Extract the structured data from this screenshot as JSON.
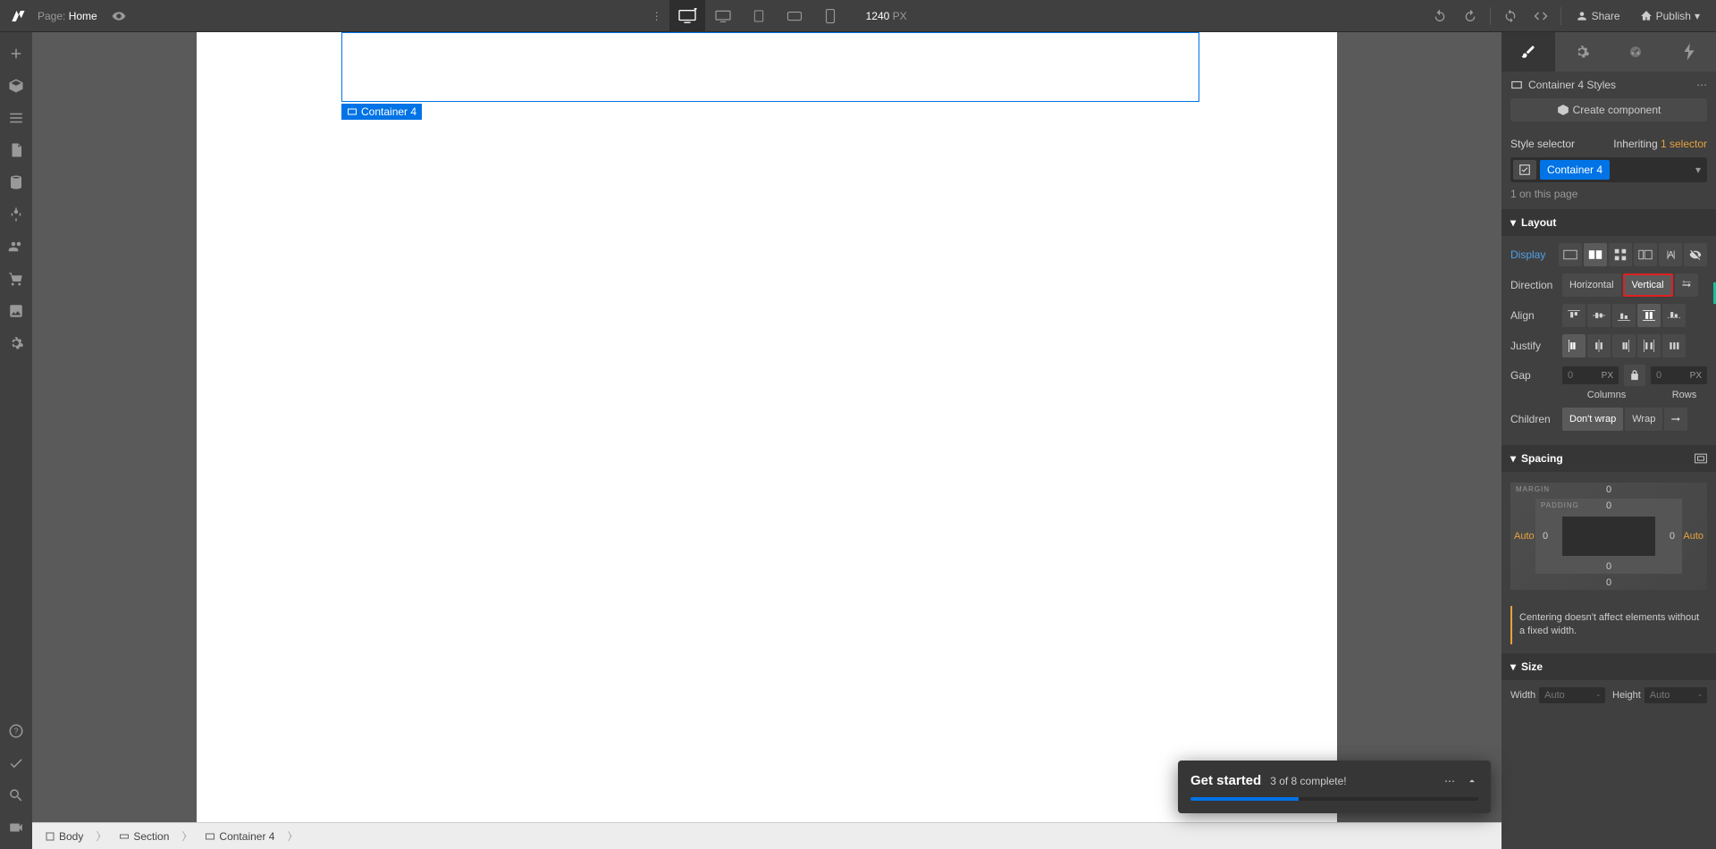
{
  "topbar": {
    "page_label": "Page:",
    "page_name": "Home",
    "width_value": "1240",
    "width_unit": "PX",
    "share": "Share",
    "publish": "Publish"
  },
  "canvas": {
    "selected_label": "Container 4"
  },
  "breadcrumb": {
    "items": [
      "Body",
      "Section",
      "Container 4"
    ]
  },
  "panel": {
    "header_title": "Container 4 Styles",
    "create_component": "Create component",
    "style_selector_label": "Style selector",
    "inheriting_prefix": "Inheriting ",
    "inheriting_link": "1 selector",
    "selector_tag": "Container 4",
    "page_count": "1 on this page"
  },
  "layout": {
    "section_title": "Layout",
    "display_label": "Display",
    "direction_label": "Direction",
    "direction_horizontal": "Horizontal",
    "direction_vertical": "Vertical",
    "align_label": "Align",
    "justify_label": "Justify",
    "gap_label": "Gap",
    "gap_col_value": "0",
    "gap_row_value": "0",
    "gap_unit": "PX",
    "columns_label": "Columns",
    "rows_label": "Rows",
    "children_label": "Children",
    "children_nowrap": "Don't wrap",
    "children_wrap": "Wrap"
  },
  "spacing": {
    "section_title": "Spacing",
    "margin_label": "MARGIN",
    "padding_label": "PADDING",
    "margin_top": "0",
    "margin_bottom": "0",
    "margin_left": "Auto",
    "margin_right": "Auto",
    "padding_top": "0",
    "padding_bottom": "0",
    "padding_left": "0",
    "padding_right": "0",
    "note": "Centering doesn't affect elements without a fixed width."
  },
  "size": {
    "section_title": "Size",
    "width_label": "Width",
    "height_label": "Height",
    "auto": "Auto",
    "dash": "-"
  },
  "get_started": {
    "title": "Get started",
    "subtitle": "3 of 8 complete!"
  }
}
